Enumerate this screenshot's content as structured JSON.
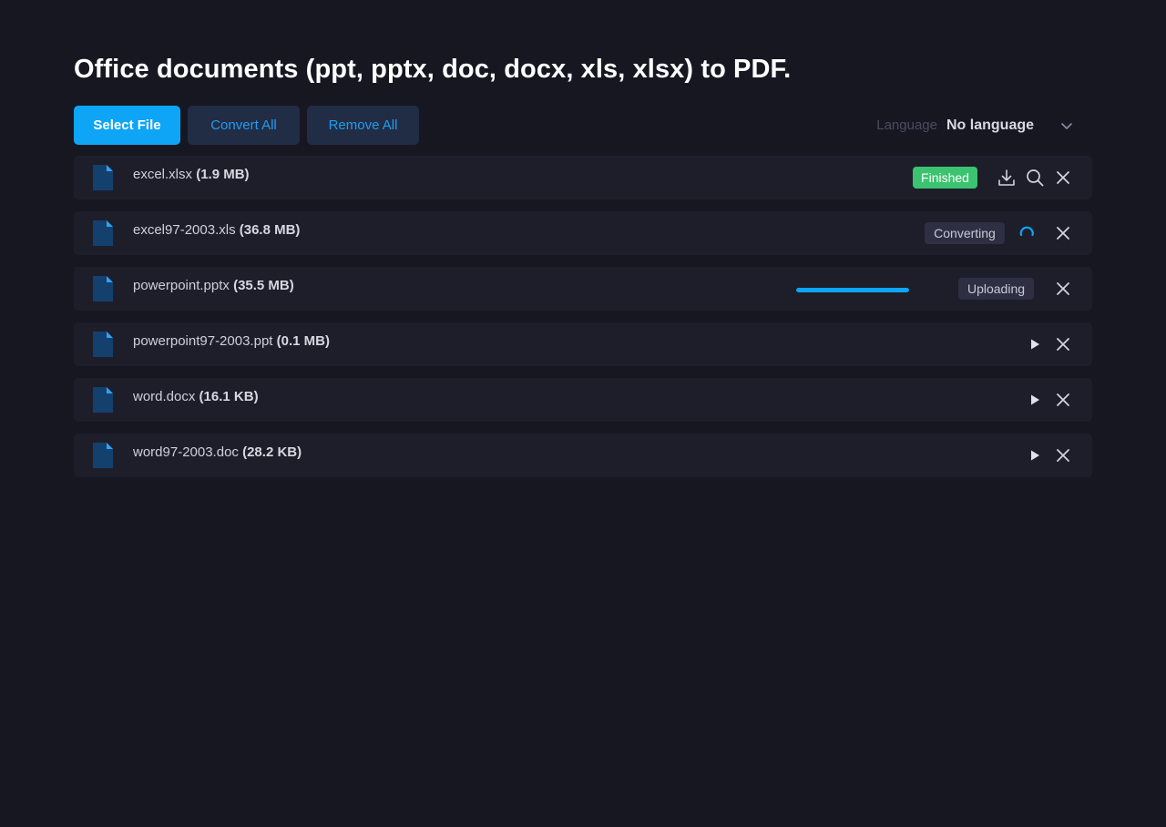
{
  "page": {
    "title": "Office documents (ppt, pptx, doc, docx, xls, xlsx) to PDF."
  },
  "toolbar": {
    "select_label": "Select File",
    "convert_all_label": "Convert All",
    "remove_all_label": "Remove All",
    "language_label": "Language",
    "language_value": "No language"
  },
  "files": [
    {
      "name": "excel.xlsx",
      "size": "(1.9 MB)",
      "status": "Finished"
    },
    {
      "name": "excel97-2003.xls",
      "size": "(36.8 MB)",
      "status": "Converting"
    },
    {
      "name": "powerpoint.pptx",
      "size": "(35.5 MB)",
      "status": "Uploading",
      "progress": 1.0
    },
    {
      "name": "powerpoint97-2003.ppt",
      "size": "(0.1 MB)",
      "status": ""
    },
    {
      "name": "word.docx",
      "size": "(16.1 KB)",
      "status": ""
    },
    {
      "name": "word97-2003.doc",
      "size": "(28.2 KB)",
      "status": ""
    }
  ],
  "colors": {
    "background": "#171722",
    "row": "#1e1e2b",
    "accent": "#0ea5f6",
    "finished": "#3cc36f",
    "file_icon": "#14406d"
  },
  "icons": {
    "file": "file-icon",
    "download": "download-icon",
    "preview": "search-icon",
    "remove": "close-icon",
    "convert": "play-icon",
    "loading": "spinner-icon",
    "dropdown": "chevron-down-icon"
  }
}
